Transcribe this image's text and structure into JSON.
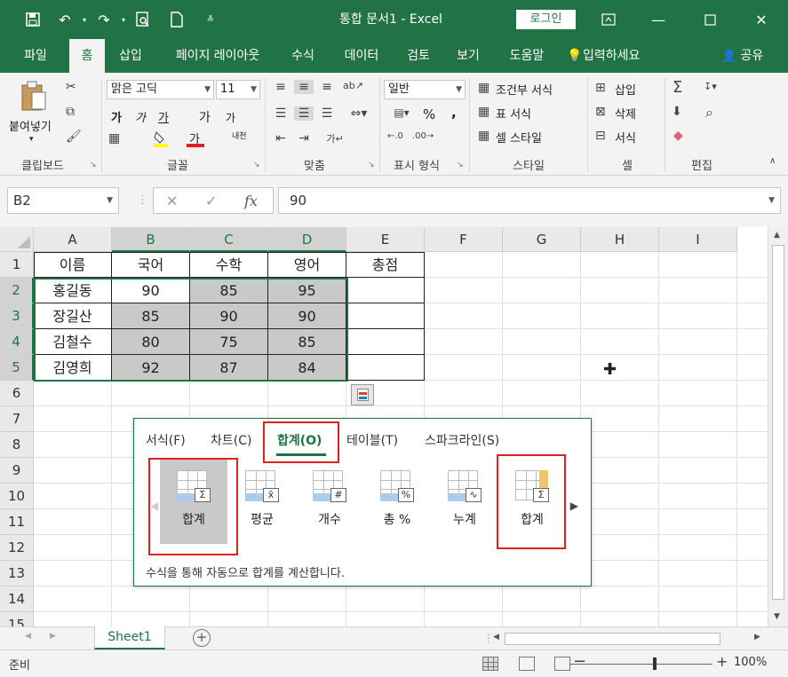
{
  "titlebar": {
    "title": "통합 문서1  -  Excel",
    "login_label": "로그인",
    "qat_icons": [
      "save-icon",
      "undo-icon",
      "redo-icon",
      "print-preview-icon",
      "new-file-icon",
      "customize-qat-icon"
    ]
  },
  "tabs": [
    {
      "label": "파일"
    },
    {
      "label": "홈",
      "active": true
    },
    {
      "label": "삽입"
    },
    {
      "label": "페이지 레이아웃"
    },
    {
      "label": "수식"
    },
    {
      "label": "데이터"
    },
    {
      "label": "검토"
    },
    {
      "label": "보기"
    },
    {
      "label": "도움말"
    },
    {
      "label": "입력하세요"
    },
    {
      "label": "공유"
    }
  ],
  "ribbon": {
    "clipboard": {
      "paste": "붙여넣기",
      "label": "클립보드"
    },
    "font": {
      "family": "맑은 고딕",
      "size": "11",
      "bold": "가",
      "italic": "가",
      "underline": "가",
      "grow": "가",
      "shrink": "가",
      "color_letter": "가",
      "phonetic": "내천",
      "label": "글꼴"
    },
    "alignment": {
      "label": "맞춤"
    },
    "number": {
      "format": "일반",
      "percent": "%",
      "comma": ",",
      "label": "표시 형식"
    },
    "styles": {
      "conditional": "조건부 서식",
      "table": "표 서식",
      "cell": "셀 스타일",
      "label": "스타일"
    },
    "cells": {
      "insert": "삽입",
      "delete": "삭제",
      "format": "서식",
      "label": "셀"
    },
    "editing": {
      "label": "편집"
    }
  },
  "formula_bar": {
    "name_box": "B2",
    "cancel": "✕",
    "enter": "✓",
    "fx": "fx",
    "value": "90"
  },
  "grid": {
    "columns": [
      "A",
      "B",
      "C",
      "D",
      "E",
      "F",
      "G",
      "H",
      "I"
    ],
    "rows": [
      "1",
      "2",
      "3",
      "4",
      "5",
      "6",
      "7",
      "8",
      "9",
      "10",
      "11",
      "12",
      "13",
      "14",
      "15"
    ],
    "headers": [
      "이름",
      "국어",
      "수학",
      "영어",
      "총점"
    ],
    "data": [
      [
        "홍길동",
        "90",
        "85",
        "95",
        ""
      ],
      [
        "장길산",
        "85",
        "90",
        "90",
        ""
      ],
      [
        "김철수",
        "80",
        "75",
        "85",
        ""
      ],
      [
        "김영희",
        "92",
        "87",
        "84",
        ""
      ]
    ]
  },
  "quick_analysis": {
    "tabs": [
      "서식(F)",
      "차트(C)",
      "합계(O)",
      "테이블(T)",
      "스파크라인(S)"
    ],
    "items": [
      {
        "label": "합계",
        "glyph": "Σ"
      },
      {
        "label": "평균",
        "glyph": "x̄"
      },
      {
        "label": "개수",
        "glyph": "#"
      },
      {
        "label": "총 %",
        "glyph": "%"
      },
      {
        "label": "누계",
        "glyph": "∿"
      },
      {
        "label": "합계",
        "glyph": "Σ"
      }
    ],
    "description": "수식을 통해 자동으로 합계를 계산합니다."
  },
  "sheetbar": {
    "sheet_name": "Sheet1",
    "add": "+"
  },
  "statusbar": {
    "status": "준비",
    "zoom": "100%"
  },
  "colors": {
    "accent": "#217346",
    "highlight_red": "#e02020",
    "selection_gray": "#c9c9c9"
  }
}
